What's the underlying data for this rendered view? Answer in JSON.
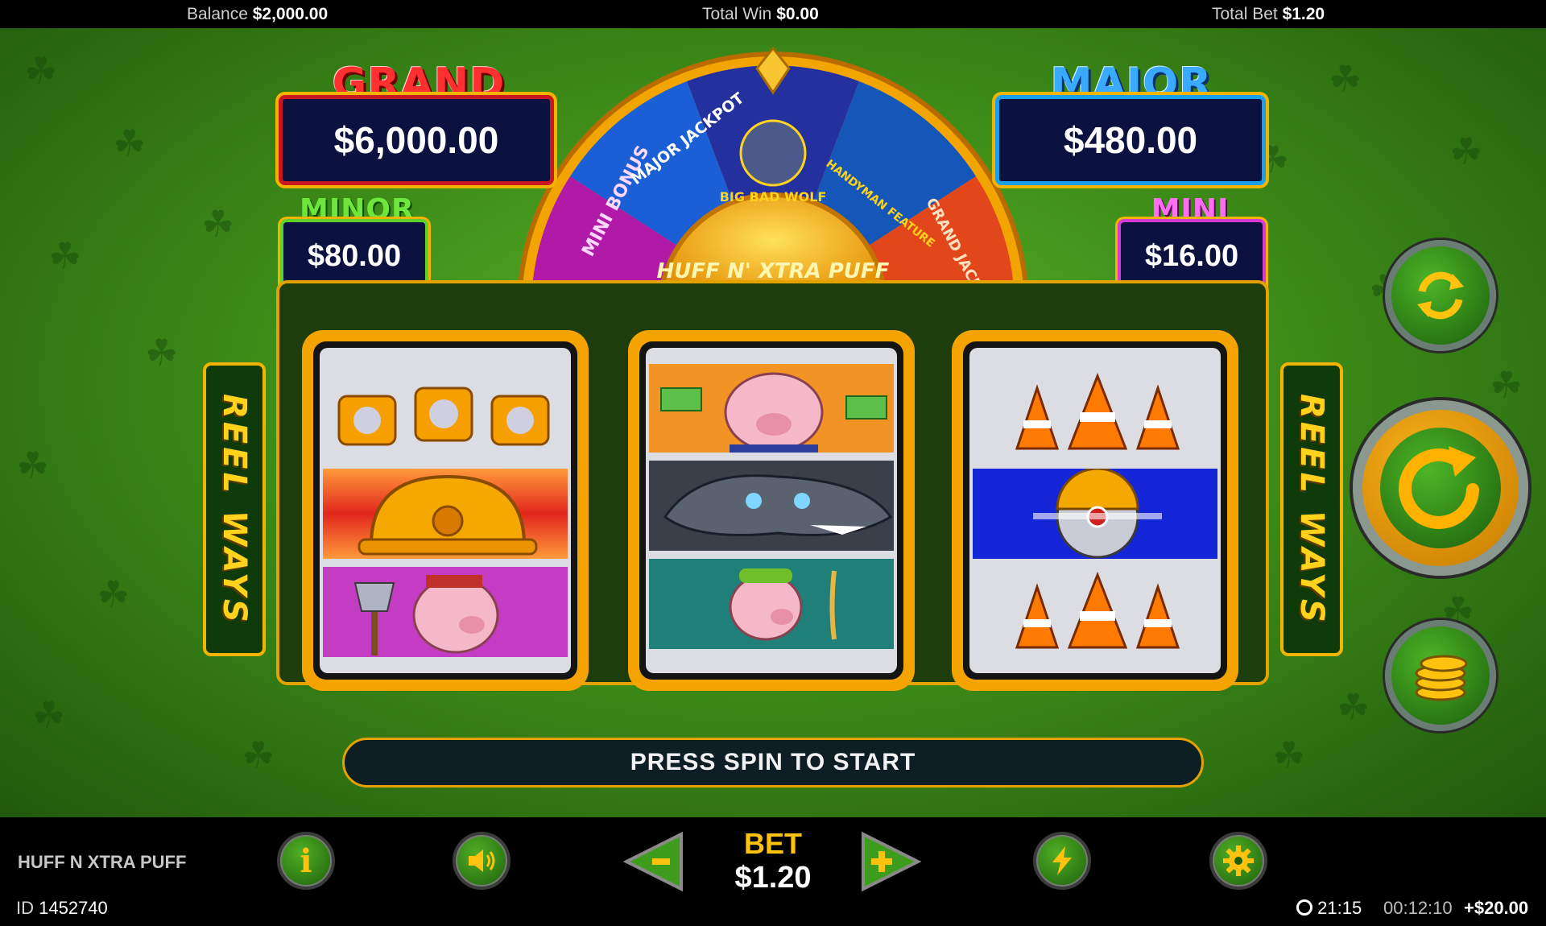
{
  "topbar": {
    "balance_label": "Balance",
    "balance_value": "$2,000.00",
    "total_win_label": "Total Win",
    "total_win_value": "$0.00",
    "total_bet_label": "Total Bet",
    "total_bet_value": "$1.20"
  },
  "jackpots": {
    "grand": {
      "title": "GRAND",
      "value": "$6,000.00"
    },
    "major": {
      "title": "MAJOR",
      "value": "$480.00"
    },
    "minor": {
      "title": "MINOR",
      "value": "$80.00"
    },
    "mini": {
      "title": "MINI",
      "value": "$16.00"
    }
  },
  "wheel": {
    "segments": [
      "MINI BONUS",
      "MAJOR JACKPOT",
      "BIG BAD WOLF",
      "HANDYMAN FEATURE",
      "GRAND JACKPOT"
    ],
    "hub_logo": "HUFF N' XTRA PUFF"
  },
  "reels": {
    "reel_1": [
      "tape-measures",
      "hard-hat",
      "axe-pig"
    ],
    "reel_2": [
      "money-pig",
      "big-bad-wolf",
      "wheat-pig"
    ],
    "reel_3": [
      "traffic-cones",
      "circular-saw",
      "traffic-cones"
    ]
  },
  "reel_ways_label": "REEL WAYS",
  "message": "PRESS SPIN TO START",
  "bottom": {
    "game_name": "HUFF N XTRA PUFF",
    "id_label": "ID",
    "id_value": "1452740",
    "bet_label": "BET",
    "bet_value": "$1.20",
    "clock": "21:15",
    "session_time": "00:12:10",
    "session_net": "+$20.00"
  },
  "colors": {
    "accent_gold": "#f5a300",
    "jackpot_navy": "#0b1240",
    "grand_red": "#e02020",
    "major_blue": "#1e90ff",
    "minor_green": "#5ed12b",
    "mini_magenta": "#e040e0"
  }
}
